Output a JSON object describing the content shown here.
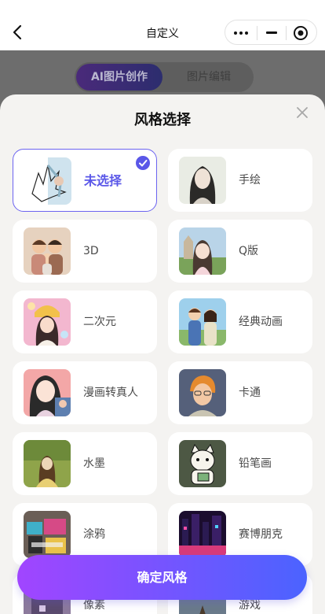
{
  "nav": {
    "title": "自定义",
    "back_icon": "chevron-left-icon",
    "capsule_icons": [
      "more-icon",
      "minimize-icon",
      "close-target-icon"
    ]
  },
  "background": {
    "tabs": [
      {
        "label": "AI图片创作",
        "active": true
      },
      {
        "label": "图片编辑",
        "active": false
      }
    ]
  },
  "sheet": {
    "title": "风格选择",
    "close_icon": "close-icon",
    "styles": [
      {
        "label": "未选择",
        "selected": true
      },
      {
        "label": "手绘",
        "selected": false
      },
      {
        "label": "3D",
        "selected": false
      },
      {
        "label": "Q版",
        "selected": false
      },
      {
        "label": "二次元",
        "selected": false
      },
      {
        "label": "经典动画",
        "selected": false
      },
      {
        "label": "漫画转真人",
        "selected": false
      },
      {
        "label": "卡通",
        "selected": false
      },
      {
        "label": "水墨",
        "selected": false
      },
      {
        "label": "铅笔画",
        "selected": false
      },
      {
        "label": "涂鸦",
        "selected": false
      },
      {
        "label": "赛博朋克",
        "selected": false
      },
      {
        "label": "像素",
        "selected": false
      },
      {
        "label": "游戏",
        "selected": false
      }
    ],
    "confirm_label": "确定风格"
  },
  "colors": {
    "accent": "#5a57e8",
    "gradient_start": "#a145ff",
    "gradient_end": "#4b63ff"
  }
}
